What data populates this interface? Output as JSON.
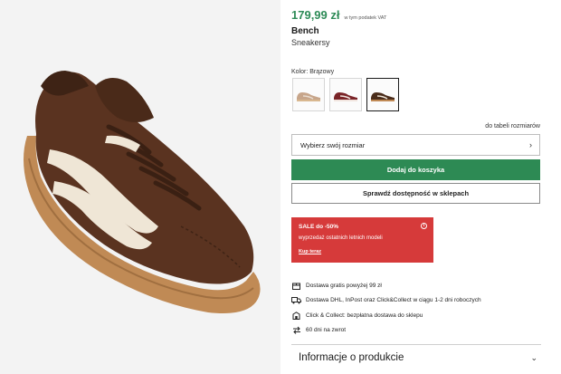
{
  "product": {
    "price": "179,99 zł",
    "vat_note": "w tym podatek VAT",
    "brand": "Bench",
    "name": "Sneakersy",
    "color_label": "Kolor: Brązowy",
    "swatches": [
      {
        "name": "beige",
        "color": "#c7a58a",
        "accent": "#e9dccf",
        "selected": false
      },
      {
        "name": "burgundy",
        "color": "#7a2428",
        "accent": "#f2e6e0",
        "selected": false
      },
      {
        "name": "brown",
        "color": "#4a2c1a",
        "accent": "#efe6da",
        "selected": true
      }
    ]
  },
  "size": {
    "chart_link": "do tabeli rozmiarów",
    "select_placeholder": "Wybierz swój rozmiar"
  },
  "actions": {
    "add_to_cart": "Dodaj do koszyka",
    "check_store": "Sprawdź dostępność w sklepach"
  },
  "sale": {
    "title": "SALE do -50%",
    "description": "wyprzedaż ostatnich letnich modeli",
    "link": "Kup teraz",
    "info_icon": "info-icon",
    "bg_color": "#d63a3a"
  },
  "benefits": [
    {
      "icon": "delivery-box-icon",
      "text": "Dostawa gratis powyżej 99 zł"
    },
    {
      "icon": "delivery-truck-icon",
      "text": "Dostawa DHL, InPost oraz Click&Collect w ciągu 1-2 dni roboczych"
    },
    {
      "icon": "click-collect-icon",
      "text": "Click & Collect: bezpłatna dostawa do sklepu"
    },
    {
      "icon": "return-arrows-icon",
      "text": "60 dni na zwrot"
    }
  ],
  "info_section": {
    "title": "Informacje o produkcie"
  },
  "colors": {
    "price_green": "#2e8b57",
    "cart_green": "#2d8a54",
    "shoe_brown": "#5a3320",
    "sole_gum": "#c08a55"
  }
}
